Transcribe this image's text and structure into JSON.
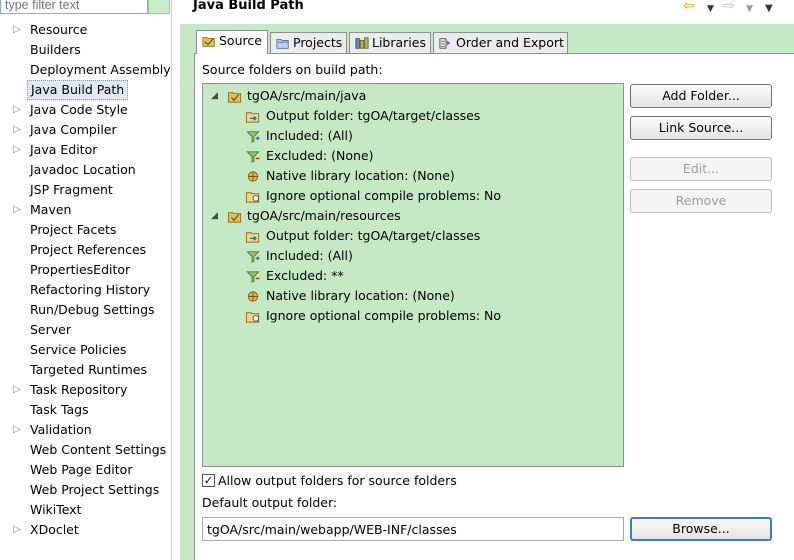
{
  "filter": {
    "placeholder": "type filter text"
  },
  "left_tree": [
    {
      "label": "Resource",
      "expandable": true
    },
    {
      "label": "Builders",
      "expandable": false
    },
    {
      "label": "Deployment Assembly",
      "expandable": false
    },
    {
      "label": "Java Build Path",
      "expandable": false,
      "selected": true
    },
    {
      "label": "Java Code Style",
      "expandable": true
    },
    {
      "label": "Java Compiler",
      "expandable": true
    },
    {
      "label": "Java Editor",
      "expandable": true
    },
    {
      "label": "Javadoc Location",
      "expandable": false
    },
    {
      "label": "JSP Fragment",
      "expandable": false
    },
    {
      "label": "Maven",
      "expandable": true
    },
    {
      "label": "Project Facets",
      "expandable": false
    },
    {
      "label": "Project References",
      "expandable": false
    },
    {
      "label": "PropertiesEditor",
      "expandable": false
    },
    {
      "label": "Refactoring History",
      "expandable": false
    },
    {
      "label": "Run/Debug Settings",
      "expandable": false
    },
    {
      "label": "Server",
      "expandable": false
    },
    {
      "label": "Service Policies",
      "expandable": false
    },
    {
      "label": "Targeted Runtimes",
      "expandable": false
    },
    {
      "label": "Task Repository",
      "expandable": true
    },
    {
      "label": "Task Tags",
      "expandable": false
    },
    {
      "label": "Validation",
      "expandable": true
    },
    {
      "label": "Web Content Settings",
      "expandable": false
    },
    {
      "label": "Web Page Editor",
      "expandable": false
    },
    {
      "label": "Web Project Settings",
      "expandable": false
    },
    {
      "label": "WikiText",
      "expandable": false
    },
    {
      "label": "XDoclet",
      "expandable": true
    }
  ],
  "header": {
    "title": "Java Build Path"
  },
  "tabs": [
    {
      "label": "Source",
      "icon": "source-folder-icon",
      "active": true
    },
    {
      "label": "Projects",
      "icon": "projects-icon",
      "active": false
    },
    {
      "label": "Libraries",
      "icon": "libraries-icon",
      "active": false
    },
    {
      "label": "Order and Export",
      "icon": "order-export-icon",
      "active": false
    }
  ],
  "source": {
    "label": "Source folders on build path:",
    "folders": [
      {
        "label": "tgOA/src/main/java",
        "children": [
          {
            "label": "Output folder: tgOA/target/classes",
            "icon": "output-folder-icon"
          },
          {
            "label": "Included: (All)",
            "icon": "inclusion-filter-icon"
          },
          {
            "label": "Excluded: (None)",
            "icon": "exclusion-filter-icon"
          },
          {
            "label": "Native library location: (None)",
            "icon": "native-library-icon"
          },
          {
            "label": "Ignore optional compile problems: No",
            "icon": "ignore-problems-icon"
          }
        ]
      },
      {
        "label": "tgOA/src/main/resources",
        "children": [
          {
            "label": "Output folder: tgOA/target/classes",
            "icon": "output-folder-icon"
          },
          {
            "label": "Included: (All)",
            "icon": "inclusion-filter-icon"
          },
          {
            "label": "Excluded: **",
            "icon": "exclusion-filter-icon"
          },
          {
            "label": "Native library location: (None)",
            "icon": "native-library-icon"
          },
          {
            "label": "Ignore optional compile problems: No",
            "icon": "ignore-problems-icon"
          }
        ]
      }
    ]
  },
  "buttons": {
    "add_folder": "Add Folder...",
    "link_source": "Link Source...",
    "edit": "Edit...",
    "remove": "Remove",
    "browse": "Browse..."
  },
  "allow_output": {
    "label": "Allow output folders for source folders",
    "checked": true
  },
  "default_output": {
    "label": "Default output folder:",
    "value": "tgOA/src/main/webapp/WEB-INF/classes"
  },
  "colors": {
    "panel_green": "#c5e8c5",
    "selection": "#dde9f5",
    "default_button_border": "#3c7fb1"
  }
}
